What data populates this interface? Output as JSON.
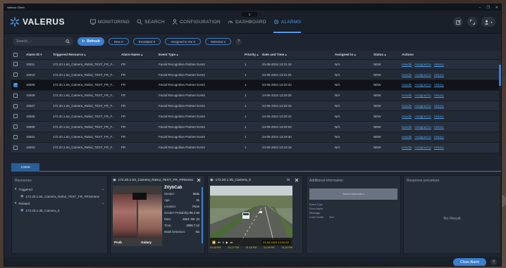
{
  "window": {
    "title": "Valerus Client",
    "min": "–",
    "max": "❐",
    "close": "✕"
  },
  "brand": {
    "name": "VALERUS",
    "accent": "#4f9de8"
  },
  "nav": {
    "items": [
      {
        "label": "MONITORING",
        "icon": "monitor-icon"
      },
      {
        "label": "SEARCH",
        "icon": "search-icon"
      },
      {
        "label": "CONFIGURATION",
        "icon": "users-icon"
      },
      {
        "label": "DASHBOARD",
        "icon": "dashboard-icon"
      },
      {
        "label": "ALARMS",
        "icon": "alarm-icon"
      }
    ],
    "notification_count": "1"
  },
  "toolbar": {
    "search_placeholder": "Search...",
    "refresh_label": "Refresh",
    "filters": [
      "New 0",
      "Escalated 0",
      "Assigned to me 0",
      "Selected 1"
    ],
    "help": "?"
  },
  "table": {
    "headers": [
      "",
      "Alarm ID ▾",
      "Triggered Resource ▴",
      "Alarm Name ▴",
      "Event Type ▴",
      "Priority ▴",
      "Date and Time ▴",
      "Assigned to ▴",
      "Status ▴",
      "Actions"
    ],
    "rows": [
      {
        "id": "10511",
        "resource": "172.20.1.64_Camera_Rahul_TEST_FR_F...",
        "name": "FR",
        "event": "Facial Recognition Partner Event",
        "priority": "1",
        "datetime": "24-05-2024 13:21:16",
        "assigned": "N/A",
        "status": "NEW",
        "checked": false
      },
      {
        "id": "10510",
        "resource": "172.20.1.64_Camera_Rahul_TEST_FR_F...",
        "name": "FR",
        "event": "Facial Recognition Partner Event",
        "priority": "1",
        "datetime": "24-05-2024 13:21:01",
        "assigned": "N/A",
        "status": "NEW",
        "checked": false
      },
      {
        "id": "10509",
        "resource": "172.20.1.64_Camera_Rahul_TEST_FR_F...",
        "name": "FR",
        "event": "Facial Recognition Partner Event",
        "priority": "1",
        "datetime": "24-05-2024 13:20:43",
        "assigned": "N/A",
        "status": "NEW",
        "checked": true
      },
      {
        "id": "10508",
        "resource": "172.20.1.64_Camera_Rahul_TEST_FR_F...",
        "name": "FR",
        "event": "Facial Recognition Partner Event",
        "priority": "1",
        "datetime": "24-05-2024 13:20:26",
        "assigned": "N/A",
        "status": "NEW",
        "checked": false
      },
      {
        "id": "10507",
        "resource": "172.20.1.64_Camera_Rahul_TEST_FR_F...",
        "name": "FR",
        "event": "Facial Recognition Partner Event",
        "priority": "1",
        "datetime": "24-05-2024 13:20:16",
        "assigned": "N/A",
        "status": "NEW",
        "checked": false
      },
      {
        "id": "10506",
        "resource": "172.20.1.64_Camera_Rahul_TEST_FR_F...",
        "name": "FR",
        "event": "Facial Recognition Partner Event",
        "priority": "1",
        "datetime": "24-05-2024 13:20:12",
        "assigned": "N/A",
        "status": "NEW",
        "checked": false
      },
      {
        "id": "10505",
        "resource": "172.20.1.64_Camera_Rahul_TEST_FR_F...",
        "name": "FR",
        "event": "Facial Recognition Partner Event",
        "priority": "1",
        "datetime": "24-05-2024 13:20:04",
        "assigned": "N/A",
        "status": "NEW",
        "checked": false
      },
      {
        "id": "10504",
        "resource": "172.20.1.64_Camera_Rahul_TEST_FR_F...",
        "name": "FR",
        "event": "Facial Recognition Partner Event",
        "priority": "1",
        "datetime": "24-05-2024 13:19:30",
        "assigned": "N/A",
        "status": "NEW",
        "checked": false
      },
      {
        "id": "10503",
        "resource": "172.20.1.64_Camera_Rahul_TEST_FR_F...",
        "name": "FR",
        "event": "Facial Recognition Partner Event",
        "priority": "1",
        "datetime": "24-05-2024 13:19:18",
        "assigned": "N/A",
        "status": "NEW",
        "checked": false
      }
    ],
    "actions": [
      "Handle",
      "Assigned to",
      "History"
    ]
  },
  "detail_tab": {
    "label": "10509"
  },
  "resources": {
    "title": "Resources",
    "triggered_label": "Triggered",
    "triggered_item": "172.20.1.64_Camera_Rahul_TEST_FR_FRSenson",
    "related_label": "Related",
    "related_item": "172.20.1.35_Camera_5"
  },
  "face_panel": {
    "title": "172.20.1.64_Camera_Rahul_TEST_FR_FRSenso",
    "probe_label": "Prob",
    "gallery_label": "Galary",
    "person_name": "2VybCab",
    "fields": [
      {
        "k": "Gender:",
        "v": "Male"
      },
      {
        "k": "Age:",
        "v": "31"
      },
      {
        "k": "Location:",
        "v": "Pune"
      },
      {
        "k": "Gender Probability:",
        "v": "95.1 84"
      },
      {
        "k": "Date:",
        "v": "2024 -05- 24"
      },
      {
        "k": "Time:",
        "v": "2005 7:12"
      },
      {
        "k": "Mask Detection:",
        "v": "No"
      }
    ]
  },
  "camera_panel": {
    "title": "172.20.1.35_Camera_5",
    "timestamp": "24-05-2024 13:20:22",
    "timeline": [
      "01:16 PM",
      "01:17 PM",
      "01:18 PM",
      "01:19 PM",
      "01:20 PM"
    ]
  },
  "additional_info": {
    "title": "Additional information",
    "button_label": "Select information",
    "fields": [
      {
        "k": "Event Type",
        "v": ""
      },
      {
        "k": "Door Name",
        "v": ""
      },
      {
        "k": "Message",
        "v": ""
      },
      {
        "k": "Card Holder",
        "v": "N/A"
      }
    ]
  },
  "response": {
    "title": "Response procedure",
    "empty": "No Result"
  },
  "footer": {
    "close_alarm": "Close Alarm",
    "help": "?"
  }
}
